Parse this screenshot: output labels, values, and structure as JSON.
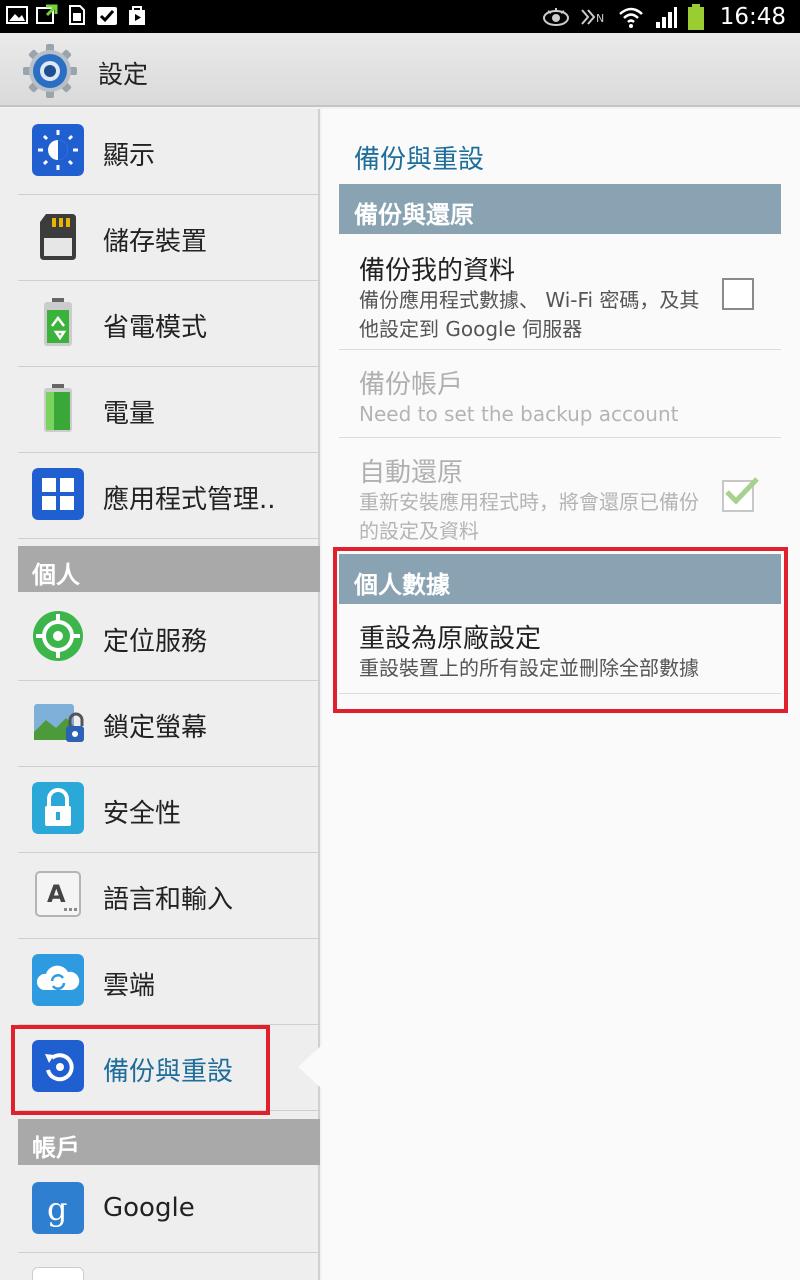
{
  "status_bar": {
    "time": "16:48",
    "left_icons": [
      "gallery-icon",
      "sync-icon",
      "sim-icon",
      "check-icon",
      "play-store-icon"
    ],
    "right_icons": [
      "eye-icon",
      "nfc-icon",
      "wifi-icon",
      "signal-icon",
      "battery-icon"
    ]
  },
  "action_bar": {
    "title": "設定",
    "icon": "settings-gear-icon"
  },
  "left_pane": {
    "items": [
      {
        "label": "顯示",
        "icon": "display-icon"
      },
      {
        "label": "儲存裝置",
        "icon": "sd-card-icon"
      },
      {
        "label": "省電模式",
        "icon": "power-saving-icon"
      },
      {
        "label": "電量",
        "icon": "battery-icon"
      },
      {
        "label": "應用程式管理..",
        "icon": "apps-grid-icon"
      }
    ],
    "section_personal": "個人",
    "personal_items": [
      {
        "label": "定位服務",
        "icon": "location-icon"
      },
      {
        "label": "鎖定螢幕",
        "icon": "lock-screen-icon"
      },
      {
        "label": "安全性",
        "icon": "padlock-icon"
      },
      {
        "label": "語言和輸入",
        "icon": "keyboard-a-icon"
      },
      {
        "label": "雲端",
        "icon": "cloud-icon"
      },
      {
        "label": "備份與重設",
        "icon": "backup-reset-icon",
        "selected": true
      }
    ],
    "section_accounts": "帳戶",
    "account_items": [
      {
        "label": "Google",
        "icon": "google-icon"
      }
    ]
  },
  "right_pane": {
    "title": "備份與重設",
    "section_backup": "備份與還原",
    "backup_my_data": {
      "title": "備份我的資料",
      "summary": "備份應用程式數據、 Wi-Fi 密碼，及其他設定到 Google 伺服器",
      "checked": false
    },
    "backup_account": {
      "title": "備份帳戶",
      "summary": "Need to set the backup account"
    },
    "auto_restore": {
      "title": "自動還原",
      "summary": "重新安裝應用程式時，將會還原已備份的設定及資料",
      "checked": true
    },
    "section_personal_data": "個人數據",
    "factory_reset": {
      "title": "重設為原廠設定",
      "summary": "重設裝置上的所有設定並刪除全部數據"
    }
  },
  "colors": {
    "accent": "#1e6d9a",
    "highlight_box": "#e0202c",
    "section_header": "#8aa3b3"
  }
}
